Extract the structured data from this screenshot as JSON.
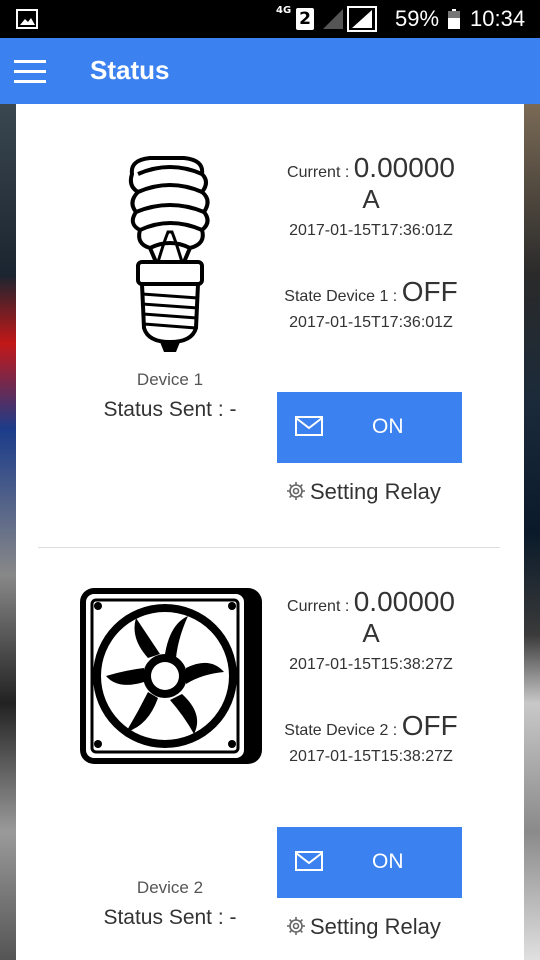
{
  "statusbar": {
    "network": "4G",
    "sim": "2",
    "battery_pct": "59%",
    "time": "10:34"
  },
  "appbar": {
    "title": "Status"
  },
  "devices": [
    {
      "icon": "lightbulb-icon",
      "name": "Device 1",
      "status_sent": "Status Sent : -",
      "current_label": "Current : ",
      "current_value": "0.00000",
      "current_unit": "A",
      "current_time": "2017-01-15T17:36:01Z",
      "state_label": "State Device 1 : ",
      "state_value": "OFF",
      "state_time": "2017-01-15T17:36:01Z",
      "button_label": "ON",
      "setting_label": "Setting Relay"
    },
    {
      "icon": "fan-icon",
      "name": "Device 2",
      "status_sent": "Status Sent : -",
      "current_label": "Current : ",
      "current_value": "0.00000",
      "current_unit": "A",
      "current_time": "2017-01-15T15:38:27Z",
      "state_label": "State Device 2 : ",
      "state_value": "OFF",
      "state_time": "2017-01-15T15:38:27Z",
      "button_label": "ON",
      "setting_label": "Setting Relay"
    }
  ],
  "colors": {
    "accent": "#3b82f0",
    "statusbar": "#000000"
  }
}
